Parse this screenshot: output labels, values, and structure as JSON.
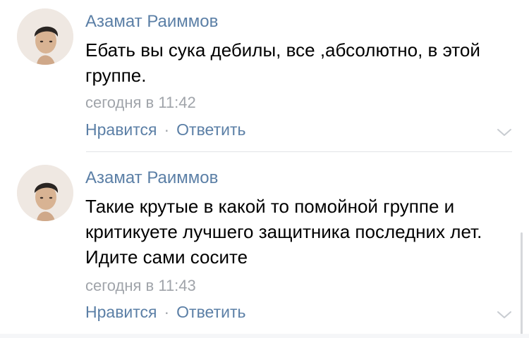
{
  "comments": [
    {
      "author": "Азамат Раиммов",
      "text": "Ебать вы сука дебилы, все ,абсолютно, в этой группе.",
      "time": "сегодня в 11:42",
      "like_label": "Нравится",
      "reply_label": "Ответить",
      "separator": "·"
    },
    {
      "author": "Азамат Раиммов",
      "text": "Такие крутые в какой то помойной группе и критикуете лучшего защитника последних лет. Идите сами сосите",
      "time": "сегодня в 11:43",
      "like_label": "Нравится",
      "reply_label": "Ответить",
      "separator": "·"
    }
  ],
  "icons": {
    "expand": "chevron-down-icon"
  },
  "colors": {
    "link": "#5b7fa6",
    "meta": "#a0a4aa",
    "text": "#000000"
  }
}
